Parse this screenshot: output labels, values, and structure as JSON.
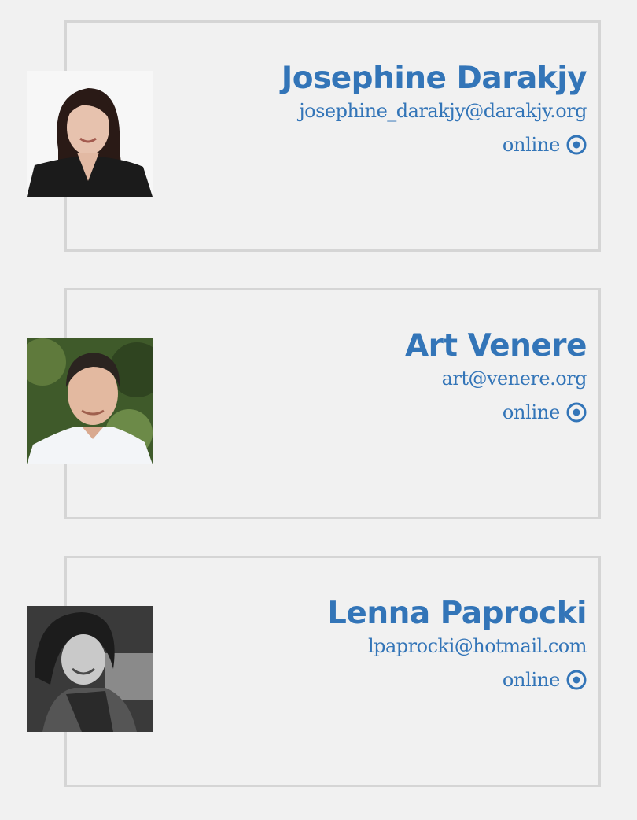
{
  "accent_color": "#3375b8",
  "contacts": [
    {
      "name": "Josephine Darakjy",
      "email": "josephine_darakjy@darakjy.org",
      "status": "online",
      "status_icon": "radio-dot-icon",
      "avatar_icon": "avatar-photo"
    },
    {
      "name": "Art Venere",
      "email": "art@venere.org",
      "status": "online",
      "status_icon": "radio-dot-icon",
      "avatar_icon": "avatar-photo"
    },
    {
      "name": "Lenna Paprocki",
      "email": "lpaprocki@hotmail.com",
      "status": "online",
      "status_icon": "radio-dot-icon",
      "avatar_icon": "avatar-photo"
    }
  ]
}
